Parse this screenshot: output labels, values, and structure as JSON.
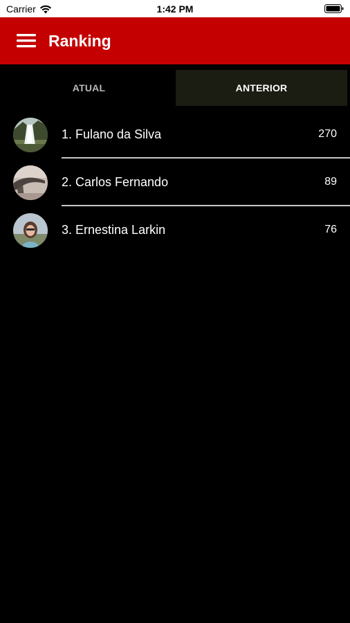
{
  "status_bar": {
    "carrier": "Carrier",
    "time": "1:42 PM"
  },
  "app_bar": {
    "title": "Ranking",
    "background": "#c40000",
    "menu_icon": "hamburger-menu-icon"
  },
  "tabs": [
    {
      "label": "ATUAL",
      "selected": false
    },
    {
      "label": "ANTERIOR",
      "selected": true
    }
  ],
  "ranking": [
    {
      "name": "1. Fulano da Silva",
      "score": "270",
      "avatar": "waterfall-photo"
    },
    {
      "name": "2. Carlos Fernando",
      "score": "89",
      "avatar": "landscape-photo"
    },
    {
      "name": "3. Ernestina Larkin",
      "score": "76",
      "avatar": "woman-portrait-photo"
    }
  ]
}
